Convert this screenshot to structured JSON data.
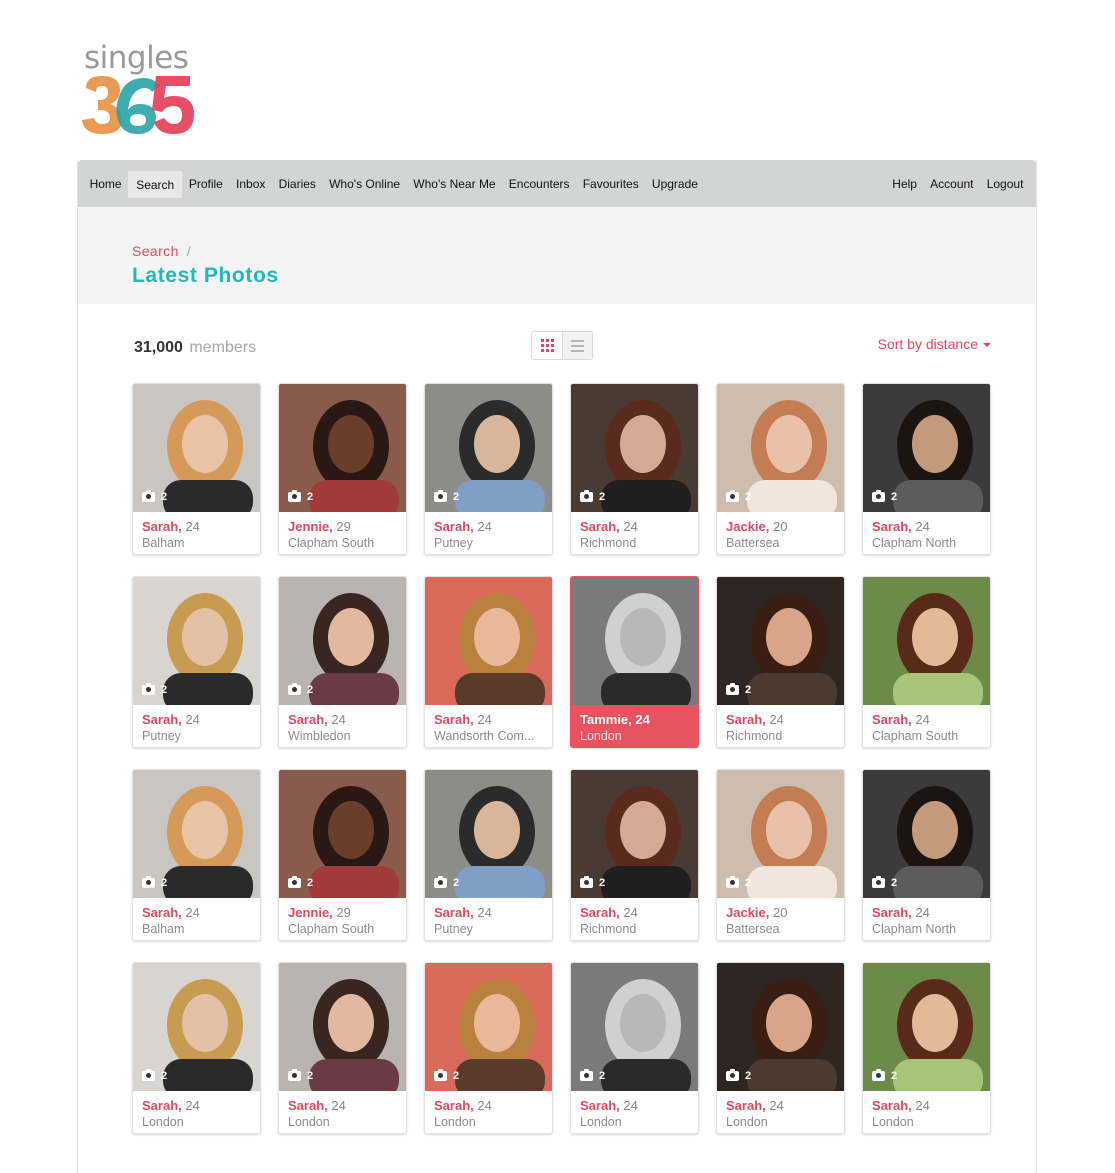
{
  "logo": {
    "word": "singles",
    "digits": "365"
  },
  "nav": {
    "left": [
      "Home",
      "Search",
      "Profile",
      "Inbox",
      "Diaries",
      "Who's Online",
      "Who's Near Me",
      "Encounters",
      "Favourites",
      "Upgrade"
    ],
    "right": [
      "Help",
      "Account",
      "Logout"
    ],
    "active": "Search"
  },
  "breadcrumb": {
    "parent": "Search",
    "separator": "/"
  },
  "page_title": "Latest Photos",
  "members": {
    "count": "31,000",
    "label": "members"
  },
  "sort_label": "Sort by distance",
  "colors": {
    "accent_red": "#e04a60",
    "accent_teal": "#26b7ba",
    "navbar": "#d3d5d5",
    "highlight": "#e7535f"
  },
  "cards": [
    {
      "name": "Sarah,",
      "age": "24",
      "location": "Balham",
      "photos": "2"
    },
    {
      "name": "Jennie,",
      "age": "29",
      "location": "Clapham South",
      "photos": "2"
    },
    {
      "name": "Sarah,",
      "age": "24",
      "location": "Putney",
      "photos": "2"
    },
    {
      "name": "Sarah,",
      "age": "24",
      "location": "Richmond",
      "photos": "2"
    },
    {
      "name": "Jackie,",
      "age": "20",
      "location": "Battersea",
      "photos": "2"
    },
    {
      "name": "Sarah,",
      "age": "24",
      "location": "Clapham North",
      "photos": "2"
    },
    {
      "name": "Sarah,",
      "age": "24",
      "location": "Putney",
      "photos": "2"
    },
    {
      "name": "Sarah,",
      "age": "24",
      "location": "Wimbledon",
      "photos": "2"
    },
    {
      "name": "Sarah,",
      "age": "24",
      "location": "Wandsorth Com...",
      "photos": ""
    },
    {
      "name": "Tammie, 24",
      "age": "",
      "location": "London",
      "photos": "",
      "highlight": true
    },
    {
      "name": "Sarah,",
      "age": "24",
      "location": "Richmond",
      "photos": "2"
    },
    {
      "name": "Sarah,",
      "age": "24",
      "location": "Clapham South",
      "photos": ""
    },
    {
      "name": "Sarah,",
      "age": "24",
      "location": "Balham",
      "photos": "2"
    },
    {
      "name": "Jennie,",
      "age": "29",
      "location": "Clapham South",
      "photos": "2"
    },
    {
      "name": "Sarah,",
      "age": "24",
      "location": "Putney",
      "photos": "2"
    },
    {
      "name": "Sarah,",
      "age": "24",
      "location": "Richmond",
      "photos": "2"
    },
    {
      "name": "Jackie,",
      "age": "20",
      "location": "Battersea",
      "photos": "2"
    },
    {
      "name": "Sarah,",
      "age": "24",
      "location": "Clapham North",
      "photos": "2"
    },
    {
      "name": "Sarah,",
      "age": "24",
      "location": "London",
      "photos": "2"
    },
    {
      "name": "Sarah,",
      "age": "24",
      "location": "London",
      "photos": "2"
    },
    {
      "name": "Sarah,",
      "age": "24",
      "location": "London",
      "photos": "2"
    },
    {
      "name": "Sarah,",
      "age": "24",
      "location": "London",
      "photos": "2"
    },
    {
      "name": "Sarah,",
      "age": "24",
      "location": "London",
      "photos": "2"
    },
    {
      "name": "Sarah,",
      "age": "24",
      "location": "London",
      "photos": "2"
    }
  ]
}
